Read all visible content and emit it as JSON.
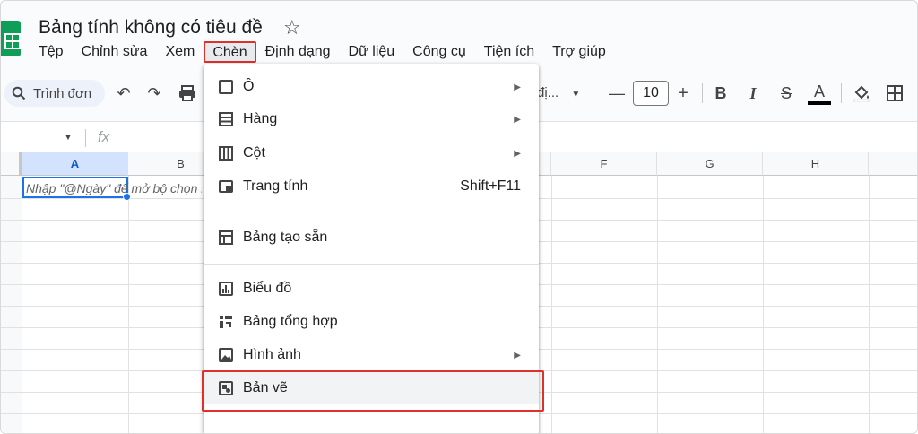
{
  "title": "Bảng tính không có tiêu đề",
  "menubar": [
    "Tệp",
    "Chỉnh sửa",
    "Xem",
    "Chèn",
    "Định dạng",
    "Dữ liệu",
    "Công cụ",
    "Tiện ích",
    "Trợ giúp"
  ],
  "active_menu": "Chèn",
  "toolbar": {
    "search_label": "Trình đơn",
    "font_short": "đị...",
    "font_size": "10",
    "minus": "—",
    "plus": "+",
    "bold": "B",
    "italic": "I",
    "strike": "S",
    "text_color": "A"
  },
  "formula": {
    "fx": "fx"
  },
  "columns": [
    "A",
    "B",
    "F",
    "G",
    "H"
  ],
  "cell_hint": "Nhập \"@Ngày\" để mở bộ chọn ngày",
  "insert_menu": {
    "items": [
      {
        "label": "Ô",
        "icon": "cell-icon",
        "submenu": true
      },
      {
        "label": "Hàng",
        "icon": "rows-icon",
        "submenu": true
      },
      {
        "label": "Cột",
        "icon": "columns-icon",
        "submenu": true
      },
      {
        "label": "Trang tính",
        "icon": "sheet-icon",
        "shortcut": "Shift+F11"
      },
      {
        "label": "Bảng tạo sẵn",
        "icon": "table-icon"
      },
      {
        "label": "Biểu đồ",
        "icon": "chart-icon"
      },
      {
        "label": "Bảng tổng hợp",
        "icon": "pivot-table-icon"
      },
      {
        "label": "Hình ảnh",
        "icon": "image-icon",
        "submenu": true
      },
      {
        "label": "Bản vẽ",
        "icon": "drawing-icon",
        "highlighted": true
      }
    ]
  },
  "colors": {
    "highlight_border": "#e0302a",
    "selection": "#1a73e8",
    "sheets_green": "#0f9d58"
  }
}
